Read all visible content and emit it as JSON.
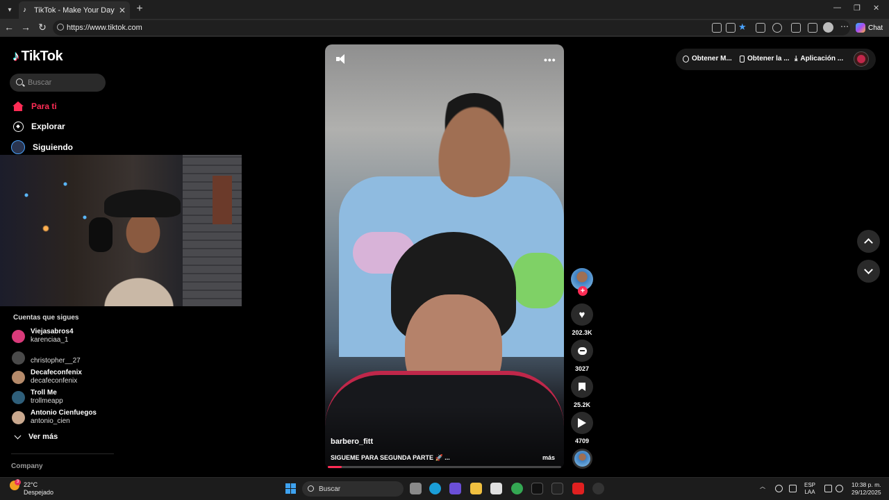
{
  "browser": {
    "tab_title": "TikTok - Make Your Day",
    "url": "https://www.tiktok.com",
    "chat_label": "Chat"
  },
  "tiktok": {
    "logo_text": "TikTok",
    "search_placeholder": "Buscar",
    "nav": [
      {
        "label": "Para ti",
        "icon": "home-icon",
        "active": true
      },
      {
        "label": "Explorar",
        "icon": "compass-icon",
        "active": false
      },
      {
        "label": "Siguiendo",
        "icon": "following-icon",
        "active": false
      }
    ],
    "following_title": "Cuentas que sigues",
    "accounts": [
      {
        "name": "Viejasabros4",
        "handle": "karenciaa_1",
        "color": "#d93a7a"
      },
      {
        "name": "",
        "handle": "christopher__27",
        "color": "#4a4a4a"
      },
      {
        "name": "Decafeconfenix",
        "handle": "decafeconfenix",
        "color": "#b58a6a"
      },
      {
        "name": "Troll Me",
        "handle": "trollmeapp",
        "color": "#2f5f7a"
      },
      {
        "name": "Antonio Cienfuegos",
        "handle": "antonio_cien",
        "color": "#c9a88e"
      }
    ],
    "see_more": "Ver más",
    "company": "Company",
    "top_actions": [
      {
        "label": "Obtener M...",
        "icon": "coin-icon"
      },
      {
        "label": "Obtener la ...",
        "icon": "phone-icon"
      },
      {
        "label": "Aplicación ...",
        "icon": "download-icon"
      }
    ],
    "video": {
      "author": "barbero_fitt",
      "caption": "SIGUEME PARA SEGUNDA PARTE 🚀 ...",
      "more": "más",
      "progress": 0.06
    },
    "actions": {
      "likes": "202.3K",
      "comments": "3027",
      "saves": "25.2K",
      "shares": "4709"
    }
  },
  "taskbar": {
    "temperature": "22°C",
    "weather": "Despejado",
    "weather_badge": "3",
    "search": "Buscar",
    "lang1": "ESP",
    "lang2": "LAA",
    "time": "10:38 p. m.",
    "date": "29/12/2025"
  }
}
